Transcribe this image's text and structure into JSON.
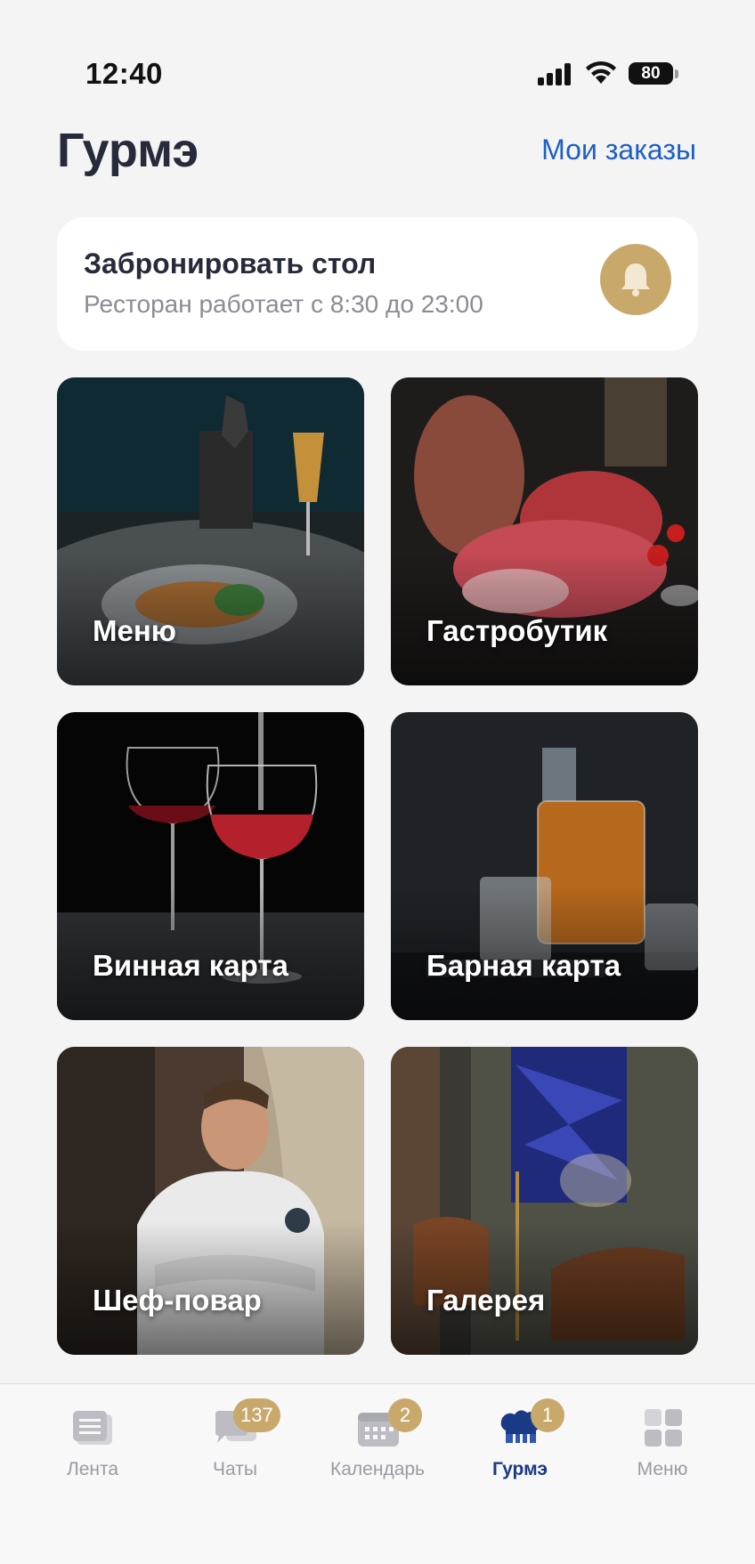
{
  "status_bar": {
    "time": "12:40",
    "battery": "80"
  },
  "header": {
    "title": "Гурмэ",
    "orders_link": "Мои заказы"
  },
  "booking": {
    "title": "Забронировать стол",
    "subtitle": "Ресторан работает с 8:30 до 23:00",
    "icon": "bell-icon"
  },
  "tiles": [
    {
      "label": "Меню"
    },
    {
      "label": "Гастробутик"
    },
    {
      "label": "Винная карта"
    },
    {
      "label": "Барная карта"
    },
    {
      "label": "Шеф-повар"
    },
    {
      "label": "Галерея"
    }
  ],
  "tab_bar": {
    "items": [
      {
        "label": "Лента",
        "icon": "feed-icon",
        "badge": ""
      },
      {
        "label": "Чаты",
        "icon": "chat-icon",
        "badge": "137"
      },
      {
        "label": "Календарь",
        "icon": "calendar-icon",
        "badge": "2"
      },
      {
        "label": "Гурмэ",
        "icon": "chef-hat-icon",
        "badge": "1"
      },
      {
        "label": "Меню",
        "icon": "grid-icon",
        "badge": ""
      }
    ],
    "active_index": 3
  },
  "colors": {
    "accent_gold": "#c9a96b",
    "link_blue": "#1f5fc4",
    "active_tab": "#1b3a86"
  }
}
